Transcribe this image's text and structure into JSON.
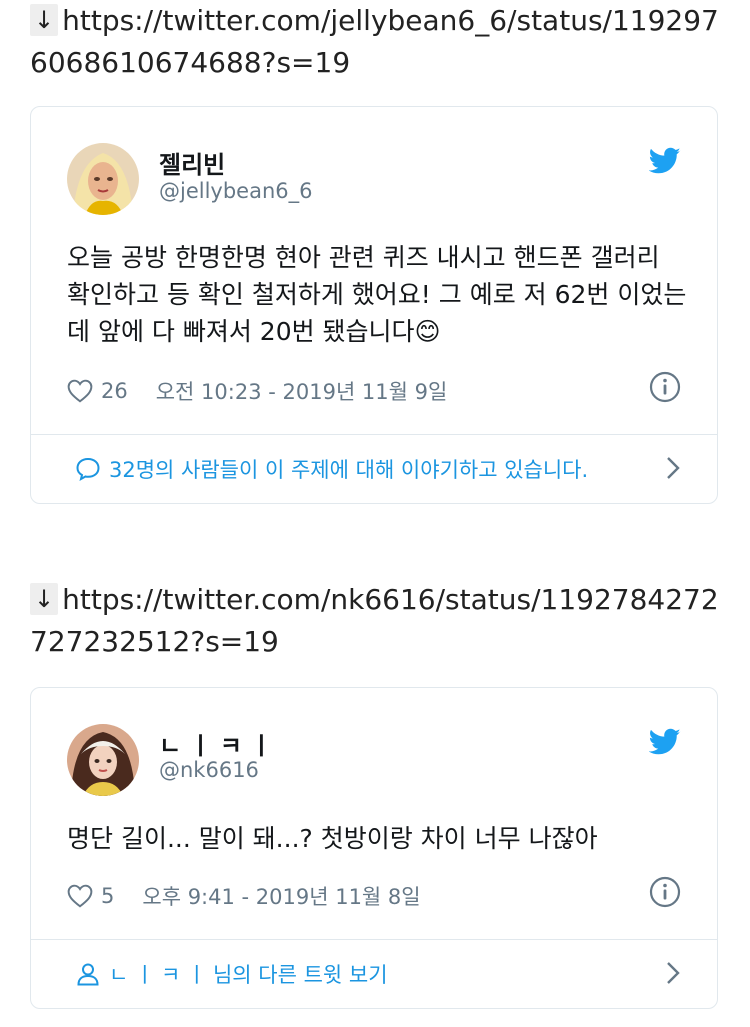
{
  "link1": {
    "arrow": "↓",
    "url": "https://twitter.com/jellybean6_6/status/1192976068610674688?s=19"
  },
  "tweet1": {
    "name": "젤리빈",
    "handle": "@jellybean6_6",
    "text": "오늘 공방 한명한명 현아 관련 퀴즈 내시고 핸드폰 갤러리 확인하고 등 확인 철저하게 했어요! 그 예로 저 62번 이었는데 앞에 다 빠져서 20번 됐습니다",
    "emoji": "😊",
    "likes": "26",
    "timestamp": "오전 10:23 - 2019년 11월 9일",
    "footer": "32명의 사람들이 이 주제에 대해 이야기하고 있습니다."
  },
  "link2": {
    "arrow": "↓",
    "url": "https://twitter.com/nk6616/status/1192784272727232512?s=19"
  },
  "tweet2": {
    "name": "ㄴ ㅣ ㅋ ㅣ",
    "handle": "@nk6616",
    "text": "명단 길이... 말이 돼...? 첫방이랑 차이 너무 나잖아",
    "likes": "5",
    "timestamp": "오후 9:41 - 2019년 11월 8일",
    "footer": "ㄴ ㅣ ㅋ ㅣ 님의 다른 트윗 보기"
  },
  "colors": {
    "accent": "#1b95e0",
    "muted": "#657786",
    "border": "#e1e8ed"
  },
  "icons": [
    "twitter-bird-icon",
    "heart-icon",
    "info-icon",
    "speech-bubble-icon",
    "person-icon",
    "chevron-right-icon"
  ]
}
